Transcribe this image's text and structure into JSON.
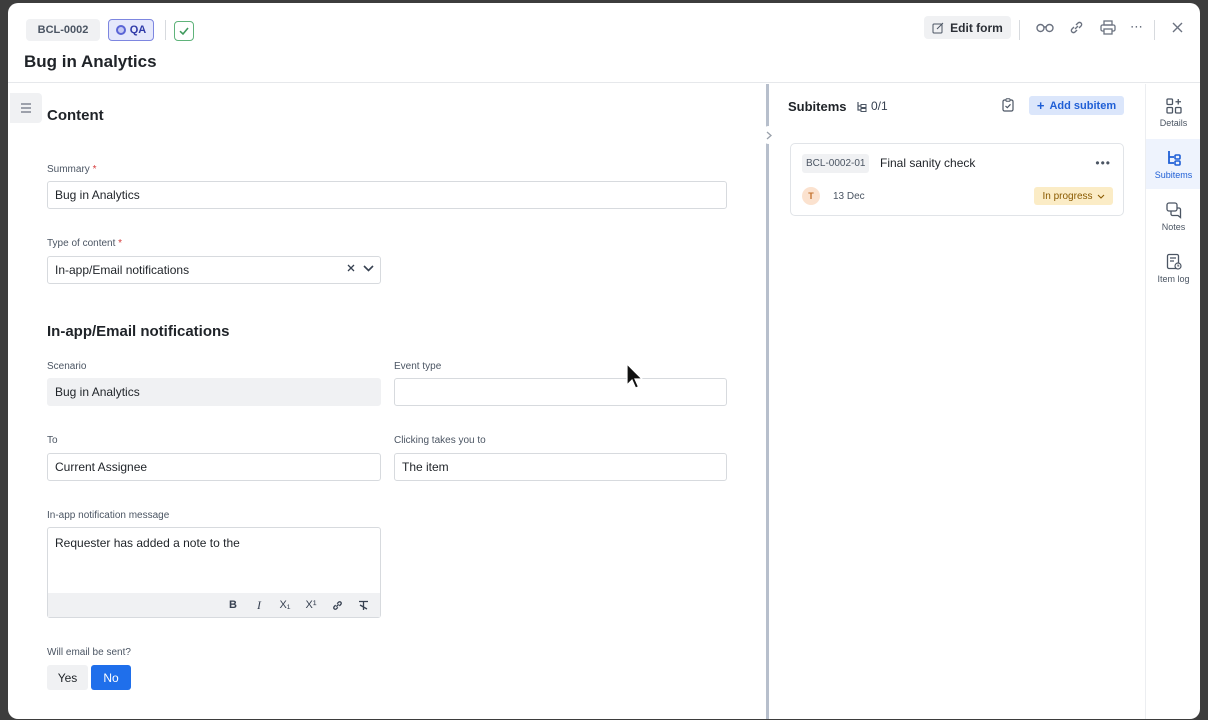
{
  "header": {
    "item_id": "BCL-0002",
    "status_chip": "QA",
    "title": "Bug in Analytics",
    "edit_form_label": "Edit form"
  },
  "content": {
    "section_title": "Content",
    "summary": {
      "label": "Summary",
      "required": "*",
      "value": "Bug in Analytics"
    },
    "type_of_content": {
      "label": "Type of content",
      "required": "*",
      "value": "In-app/Email notifications"
    },
    "notifications_section_title": "In-app/Email notifications",
    "scenario": {
      "label": "Scenario",
      "value": "Bug in Analytics"
    },
    "event_type": {
      "label": "Event type",
      "value": ""
    },
    "to": {
      "label": "To",
      "value": "Current Assignee"
    },
    "clicking_takes_you_to": {
      "label": "Clicking takes you to",
      "value": "The item"
    },
    "inapp_message": {
      "label": "In-app notification message",
      "value": "Requester has added a note to the"
    },
    "toolbar": {
      "bold": "B",
      "italic": "I",
      "subscript": "X₁",
      "superscript": "X¹",
      "link": "🔗",
      "clear_format": "T̶"
    },
    "email_sent": {
      "label": "Will email be sent?",
      "yes": "Yes",
      "no": "No",
      "selected": "No"
    }
  },
  "subitems": {
    "title": "Subitems",
    "count": "0/1",
    "add_label": "Add subitem",
    "items": [
      {
        "id": "BCL-0002-01",
        "title": "Final sanity check",
        "assignee_initial": "T",
        "date": "13 Dec",
        "status": "In progress"
      }
    ]
  },
  "rail": [
    {
      "label": "Details",
      "icon": "details-icon"
    },
    {
      "label": "Subitems",
      "icon": "subitems-icon",
      "active": true
    },
    {
      "label": "Notes",
      "icon": "notes-icon"
    },
    {
      "label": "Item log",
      "icon": "item-log-icon"
    }
  ],
  "colors": {
    "accent": "#1f6feb",
    "qa_chip": "#e5e8fb",
    "status_in_progress": "#fbecc6"
  }
}
